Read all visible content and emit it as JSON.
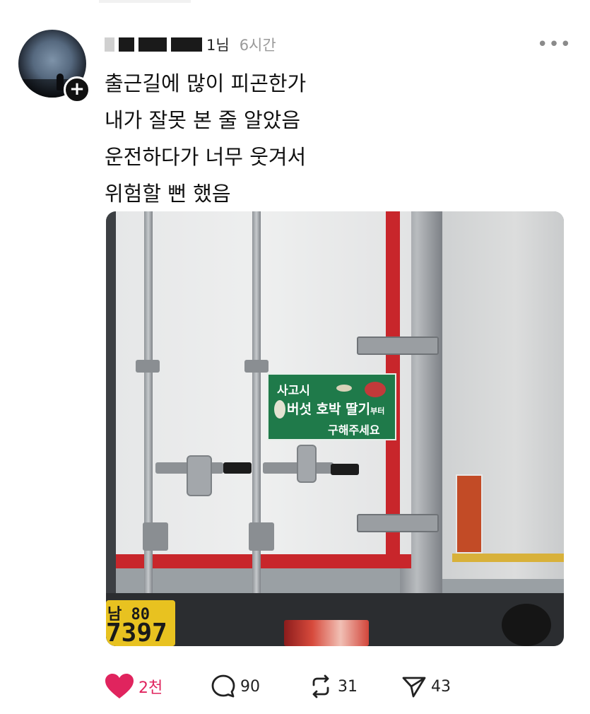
{
  "post": {
    "author": {
      "name_visible_suffix": "1님",
      "avatar_icon": "avatar-image",
      "follow_icon": "plus-icon"
    },
    "time": "6시간",
    "menu_icon": "more-icon",
    "text_lines": [
      "출근길에 많이 피곤한가",
      "내가 잘못 본 줄 알았음",
      "운전하다가 너무 웃겨서",
      "위험할 뻔 했음"
    ]
  },
  "photo": {
    "sign": {
      "line1": "사고시",
      "line2": "버섯 호박 딸기",
      "line2_suffix": "부터",
      "line3": "구해주세요"
    },
    "plate": {
      "line1": "남 80",
      "line2": "7397"
    }
  },
  "actions": {
    "like": {
      "icon": "heart-icon",
      "count": "2천",
      "color": "#e0245e"
    },
    "comment": {
      "icon": "comment-icon",
      "count": "90"
    },
    "repost": {
      "icon": "repost-icon",
      "count": "31"
    },
    "share": {
      "icon": "send-icon",
      "count": "43"
    }
  }
}
